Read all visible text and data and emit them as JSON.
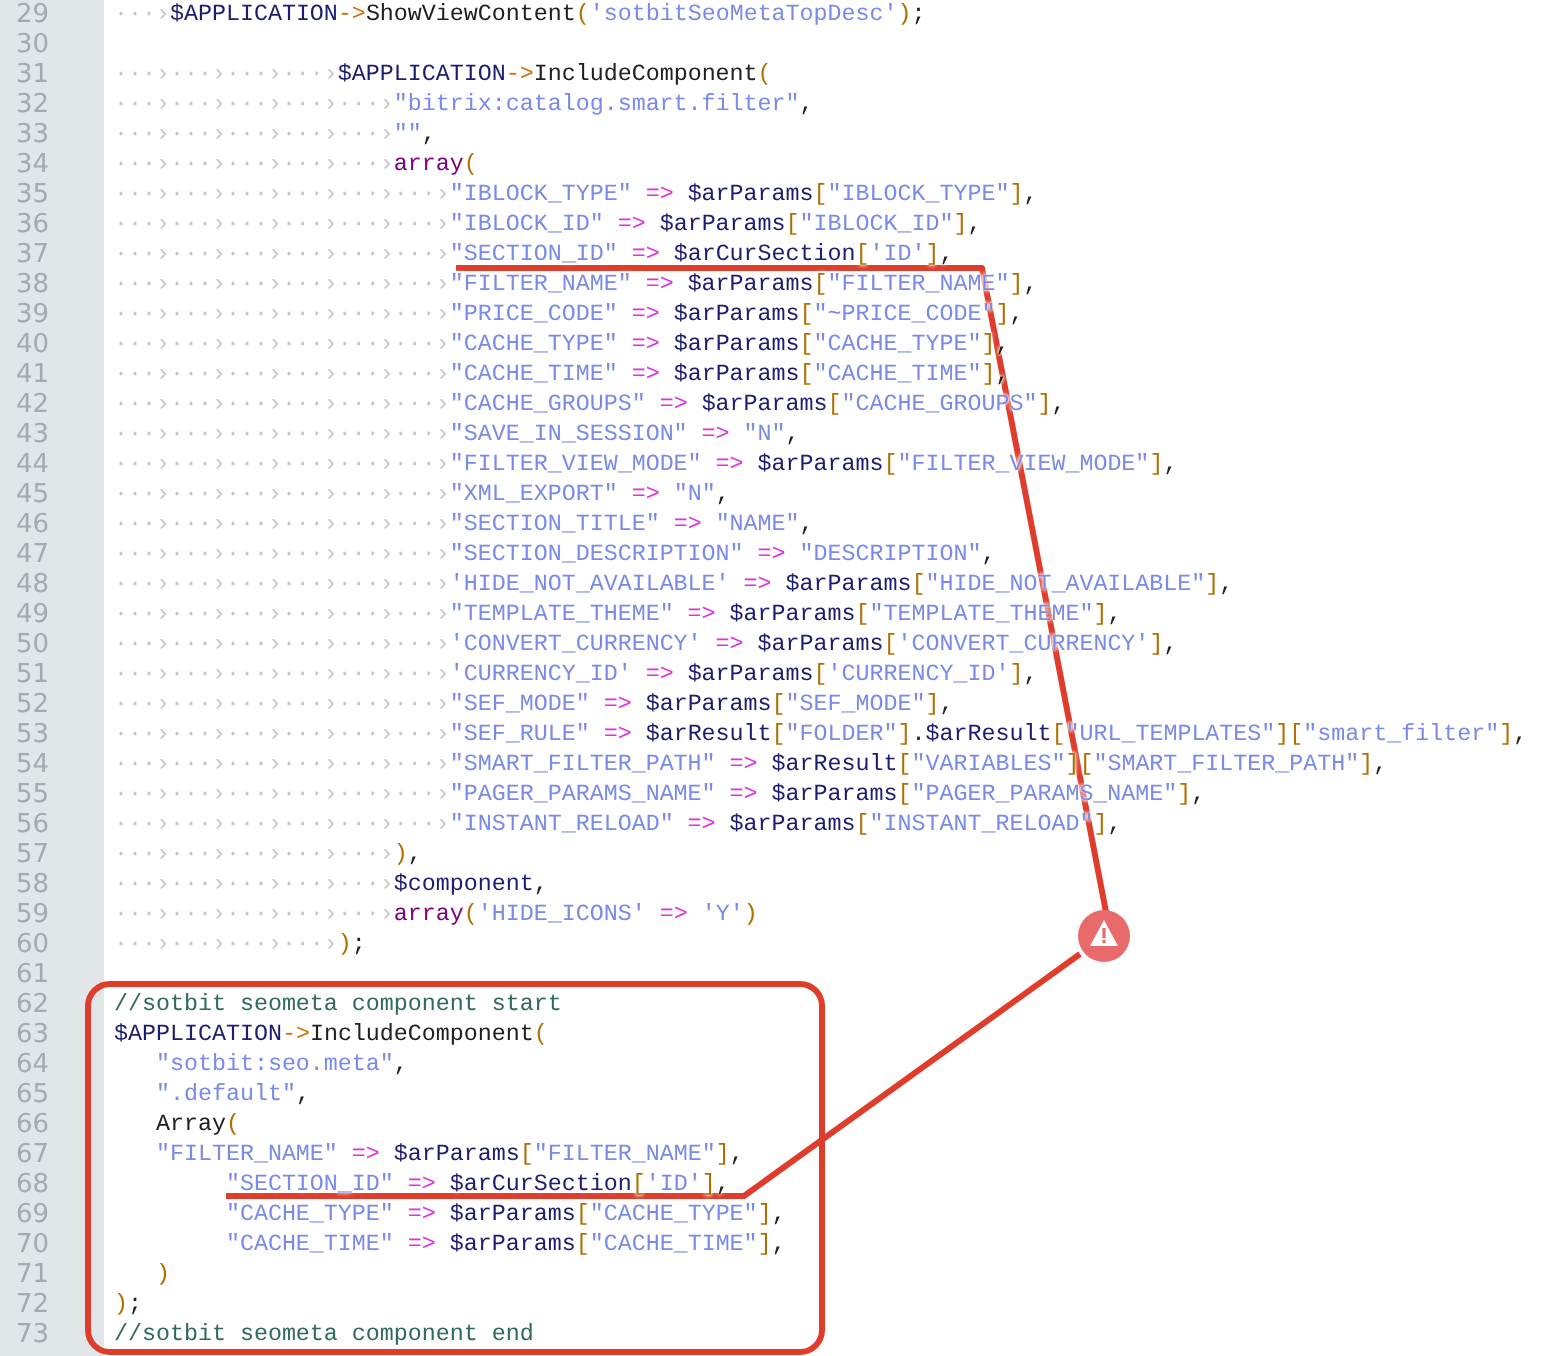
{
  "editor": {
    "lines": [
      {
        "number": "29",
        "whitespace": "···›",
        "tokens": [
          {
            "kind": "var",
            "text": "$APPLICATION"
          },
          {
            "kind": "arrow",
            "text": "->"
          },
          {
            "kind": "func",
            "text": "ShowViewContent"
          },
          {
            "kind": "punct",
            "text": "("
          },
          {
            "kind": "str",
            "text": "'sotbitSeoMetaTopDesc'"
          },
          {
            "kind": "punct",
            "text": ")"
          },
          {
            "kind": "plain",
            "text": ";"
          }
        ]
      },
      {
        "number": "30"
      },
      {
        "number": "31",
        "whitespace": "···›···›···›···›",
        "tokens": [
          {
            "kind": "var",
            "text": "$APPLICATION"
          },
          {
            "kind": "arrow",
            "text": "->"
          },
          {
            "kind": "func",
            "text": "IncludeComponent"
          },
          {
            "kind": "punct",
            "text": "("
          }
        ]
      },
      {
        "number": "32",
        "whitespace": "···›···›···›···›···›",
        "tokens": [
          {
            "kind": "str",
            "text": "\"bitrix:catalog.smart.filter\""
          },
          {
            "kind": "plain",
            "text": ","
          }
        ]
      },
      {
        "number": "33",
        "whitespace": "···›···›···›···›···›",
        "tokens": [
          {
            "kind": "str",
            "text": "\"\""
          },
          {
            "kind": "plain",
            "text": ","
          }
        ]
      },
      {
        "number": "34",
        "whitespace": "···›···›···›···›···›",
        "tokens": [
          {
            "kind": "kw",
            "text": "array"
          },
          {
            "kind": "punct",
            "text": "("
          }
        ]
      },
      {
        "number": "35",
        "whitespace": "···›···›···›···›···›···›",
        "tokens": [
          {
            "kind": "str",
            "text": "\"IBLOCK_TYPE\""
          },
          {
            "kind": "op",
            "text": " => "
          },
          {
            "kind": "var",
            "text": "$arParams"
          },
          {
            "kind": "punct",
            "text": "["
          },
          {
            "kind": "str",
            "text": "\"IBLOCK_TYPE\""
          },
          {
            "kind": "punct",
            "text": "]"
          },
          {
            "kind": "plain",
            "text": ","
          }
        ]
      },
      {
        "number": "36",
        "whitespace": "···›···›···›···›···›···›",
        "tokens": [
          {
            "kind": "str",
            "text": "\"IBLOCK_ID\""
          },
          {
            "kind": "op",
            "text": " => "
          },
          {
            "kind": "var",
            "text": "$arParams"
          },
          {
            "kind": "punct",
            "text": "["
          },
          {
            "kind": "str",
            "text": "\"IBLOCK_ID\""
          },
          {
            "kind": "punct",
            "text": "]"
          },
          {
            "kind": "plain",
            "text": ","
          }
        ]
      },
      {
        "number": "37",
        "whitespace": "···›···›···›···›···›···›",
        "tokens": [
          {
            "kind": "str",
            "text": "\"SECTION_ID\""
          },
          {
            "kind": "op",
            "text": " => "
          },
          {
            "kind": "var",
            "text": "$arCurSection"
          },
          {
            "kind": "punct",
            "text": "["
          },
          {
            "kind": "str",
            "text": "'ID'"
          },
          {
            "kind": "punct",
            "text": "]"
          },
          {
            "kind": "plain",
            "text": ","
          }
        ]
      },
      {
        "number": "38",
        "whitespace": "···›···›···›···›···›···›",
        "tokens": [
          {
            "kind": "str",
            "text": "\"FILTER_NAME\""
          },
          {
            "kind": "op",
            "text": " => "
          },
          {
            "kind": "var",
            "text": "$arParams"
          },
          {
            "kind": "punct",
            "text": "["
          },
          {
            "kind": "str",
            "text": "\"FILTER_NAME\""
          },
          {
            "kind": "punct",
            "text": "]"
          },
          {
            "kind": "plain",
            "text": ","
          }
        ]
      },
      {
        "number": "39",
        "whitespace": "···›···›···›···›···›···›",
        "tokens": [
          {
            "kind": "str",
            "text": "\"PRICE_CODE\""
          },
          {
            "kind": "op",
            "text": " => "
          },
          {
            "kind": "var",
            "text": "$arParams"
          },
          {
            "kind": "punct",
            "text": "["
          },
          {
            "kind": "str",
            "text": "\"~PRICE_CODE\""
          },
          {
            "kind": "punct",
            "text": "]"
          },
          {
            "kind": "plain",
            "text": ","
          }
        ]
      },
      {
        "number": "40",
        "whitespace": "···›···›···›···›···›···›",
        "tokens": [
          {
            "kind": "str",
            "text": "\"CACHE_TYPE\""
          },
          {
            "kind": "op",
            "text": " => "
          },
          {
            "kind": "var",
            "text": "$arParams"
          },
          {
            "kind": "punct",
            "text": "["
          },
          {
            "kind": "str",
            "text": "\"CACHE_TYPE\""
          },
          {
            "kind": "punct",
            "text": "]"
          },
          {
            "kind": "plain",
            "text": ","
          }
        ]
      },
      {
        "number": "41",
        "whitespace": "···›···›···›···›···›···›",
        "tokens": [
          {
            "kind": "str",
            "text": "\"CACHE_TIME\""
          },
          {
            "kind": "op",
            "text": " => "
          },
          {
            "kind": "var",
            "text": "$arParams"
          },
          {
            "kind": "punct",
            "text": "["
          },
          {
            "kind": "str",
            "text": "\"CACHE_TIME\""
          },
          {
            "kind": "punct",
            "text": "]"
          },
          {
            "kind": "plain",
            "text": ","
          }
        ]
      },
      {
        "number": "42",
        "whitespace": "···›···›···›···›···›···›",
        "tokens": [
          {
            "kind": "str",
            "text": "\"CACHE_GROUPS\""
          },
          {
            "kind": "op",
            "text": " => "
          },
          {
            "kind": "var",
            "text": "$arParams"
          },
          {
            "kind": "punct",
            "text": "["
          },
          {
            "kind": "str",
            "text": "\"CACHE_GROUPS\""
          },
          {
            "kind": "punct",
            "text": "]"
          },
          {
            "kind": "plain",
            "text": ","
          }
        ]
      },
      {
        "number": "43",
        "whitespace": "···›···›···›···›···›···›",
        "tokens": [
          {
            "kind": "str",
            "text": "\"SAVE_IN_SESSION\""
          },
          {
            "kind": "op",
            "text": " => "
          },
          {
            "kind": "str",
            "text": "\"N\""
          },
          {
            "kind": "plain",
            "text": ","
          }
        ]
      },
      {
        "number": "44",
        "whitespace": "···›···›···›···›···›···›",
        "tokens": [
          {
            "kind": "str",
            "text": "\"FILTER_VIEW_MODE\""
          },
          {
            "kind": "op",
            "text": " => "
          },
          {
            "kind": "var",
            "text": "$arParams"
          },
          {
            "kind": "punct",
            "text": "["
          },
          {
            "kind": "str",
            "text": "\"FILTER_VIEW_MODE\""
          },
          {
            "kind": "punct",
            "text": "]"
          },
          {
            "kind": "plain",
            "text": ","
          }
        ]
      },
      {
        "number": "45",
        "whitespace": "···›···›···›···›···›···›",
        "tokens": [
          {
            "kind": "str",
            "text": "\"XML_EXPORT\""
          },
          {
            "kind": "op",
            "text": " => "
          },
          {
            "kind": "str",
            "text": "\"N\""
          },
          {
            "kind": "plain",
            "text": ","
          }
        ]
      },
      {
        "number": "46",
        "whitespace": "···›···›···›···›···›···›",
        "tokens": [
          {
            "kind": "str",
            "text": "\"SECTION_TITLE\""
          },
          {
            "kind": "op",
            "text": " => "
          },
          {
            "kind": "str",
            "text": "\"NAME\""
          },
          {
            "kind": "plain",
            "text": ","
          }
        ]
      },
      {
        "number": "47",
        "whitespace": "···›···›···›···›···›···›",
        "tokens": [
          {
            "kind": "str",
            "text": "\"SECTION_DESCRIPTION\""
          },
          {
            "kind": "op",
            "text": " => "
          },
          {
            "kind": "str",
            "text": "\"DESCRIPTION\""
          },
          {
            "kind": "plain",
            "text": ","
          }
        ]
      },
      {
        "number": "48",
        "whitespace": "···›···›···›···›···›···›",
        "tokens": [
          {
            "kind": "str",
            "text": "'HIDE_NOT_AVAILABLE'"
          },
          {
            "kind": "op",
            "text": " => "
          },
          {
            "kind": "var",
            "text": "$arParams"
          },
          {
            "kind": "punct",
            "text": "["
          },
          {
            "kind": "str",
            "text": "\"HIDE_NOT_AVAILABLE\""
          },
          {
            "kind": "punct",
            "text": "]"
          },
          {
            "kind": "plain",
            "text": ","
          }
        ]
      },
      {
        "number": "49",
        "whitespace": "···›···›···›···›···›···›",
        "tokens": [
          {
            "kind": "str",
            "text": "\"TEMPLATE_THEME\""
          },
          {
            "kind": "op",
            "text": " => "
          },
          {
            "kind": "var",
            "text": "$arParams"
          },
          {
            "kind": "punct",
            "text": "["
          },
          {
            "kind": "str",
            "text": "\"TEMPLATE_THEME\""
          },
          {
            "kind": "punct",
            "text": "]"
          },
          {
            "kind": "plain",
            "text": ","
          }
        ]
      },
      {
        "number": "50",
        "whitespace": "···›···›···›···›···›···›",
        "tokens": [
          {
            "kind": "str",
            "text": "'CONVERT_CURRENCY'"
          },
          {
            "kind": "op",
            "text": " => "
          },
          {
            "kind": "var",
            "text": "$arParams"
          },
          {
            "kind": "punct",
            "text": "["
          },
          {
            "kind": "str",
            "text": "'CONVERT_CURRENCY'"
          },
          {
            "kind": "punct",
            "text": "]"
          },
          {
            "kind": "plain",
            "text": ","
          }
        ]
      },
      {
        "number": "51",
        "whitespace": "···›···›···›···›···›···›",
        "tokens": [
          {
            "kind": "str",
            "text": "'CURRENCY_ID'"
          },
          {
            "kind": "op",
            "text": " => "
          },
          {
            "kind": "var",
            "text": "$arParams"
          },
          {
            "kind": "punct",
            "text": "["
          },
          {
            "kind": "str",
            "text": "'CURRENCY_ID'"
          },
          {
            "kind": "punct",
            "text": "]"
          },
          {
            "kind": "plain",
            "text": ","
          }
        ]
      },
      {
        "number": "52",
        "whitespace": "···›···›···›···›···›···›",
        "tokens": [
          {
            "kind": "str",
            "text": "\"SEF_MODE\""
          },
          {
            "kind": "op",
            "text": " => "
          },
          {
            "kind": "var",
            "text": "$arParams"
          },
          {
            "kind": "punct",
            "text": "["
          },
          {
            "kind": "str",
            "text": "\"SEF_MODE\""
          },
          {
            "kind": "punct",
            "text": "]"
          },
          {
            "kind": "plain",
            "text": ","
          }
        ]
      },
      {
        "number": "53",
        "whitespace": "···›···›···›···›···›···›",
        "tokens": [
          {
            "kind": "str",
            "text": "\"SEF_RULE\""
          },
          {
            "kind": "op",
            "text": " => "
          },
          {
            "kind": "var",
            "text": "$arResult"
          },
          {
            "kind": "punct",
            "text": "["
          },
          {
            "kind": "str",
            "text": "\"FOLDER\""
          },
          {
            "kind": "punct",
            "text": "]"
          },
          {
            "kind": "plain",
            "text": "."
          },
          {
            "kind": "var",
            "text": "$arResult"
          },
          {
            "kind": "punct",
            "text": "["
          },
          {
            "kind": "str",
            "text": "\"URL_TEMPLATES\""
          },
          {
            "kind": "punct",
            "text": "]["
          },
          {
            "kind": "str",
            "text": "\"smart_filter\""
          },
          {
            "kind": "punct",
            "text": "]"
          },
          {
            "kind": "plain",
            "text": ","
          }
        ]
      },
      {
        "number": "54",
        "whitespace": "···›···›···›···›···›···›",
        "tokens": [
          {
            "kind": "str",
            "text": "\"SMART_FILTER_PATH\""
          },
          {
            "kind": "op",
            "text": " => "
          },
          {
            "kind": "var",
            "text": "$arResult"
          },
          {
            "kind": "punct",
            "text": "["
          },
          {
            "kind": "str",
            "text": "\"VARIABLES\""
          },
          {
            "kind": "punct",
            "text": "]["
          },
          {
            "kind": "str",
            "text": "\"SMART_FILTER_PATH\""
          },
          {
            "kind": "punct",
            "text": "]"
          },
          {
            "kind": "plain",
            "text": ","
          }
        ]
      },
      {
        "number": "55",
        "whitespace": "···›···›···›···›···›···›",
        "tokens": [
          {
            "kind": "str",
            "text": "\"PAGER_PARAMS_NAME\""
          },
          {
            "kind": "op",
            "text": " => "
          },
          {
            "kind": "var",
            "text": "$arParams"
          },
          {
            "kind": "punct",
            "text": "["
          },
          {
            "kind": "str",
            "text": "\"PAGER_PARAMS_NAME\""
          },
          {
            "kind": "punct",
            "text": "]"
          },
          {
            "kind": "plain",
            "text": ","
          }
        ]
      },
      {
        "number": "56",
        "whitespace": "···›···›···›···›···›···›",
        "tokens": [
          {
            "kind": "str",
            "text": "\"INSTANT_RELOAD\""
          },
          {
            "kind": "op",
            "text": " => "
          },
          {
            "kind": "var",
            "text": "$arParams"
          },
          {
            "kind": "punct",
            "text": "["
          },
          {
            "kind": "str",
            "text": "\"INSTANT_RELOAD\""
          },
          {
            "kind": "punct",
            "text": "]"
          },
          {
            "kind": "plain",
            "text": ","
          }
        ]
      },
      {
        "number": "57",
        "whitespace": "···›···›···›···›···›",
        "tokens": [
          {
            "kind": "punct",
            "text": ")"
          },
          {
            "kind": "plain",
            "text": ","
          }
        ]
      },
      {
        "number": "58",
        "whitespace": "···›···›···›···›···›",
        "tokens": [
          {
            "kind": "var",
            "text": "$component"
          },
          {
            "kind": "plain",
            "text": ","
          }
        ]
      },
      {
        "number": "59",
        "whitespace": "···›···›···›···›···›",
        "tokens": [
          {
            "kind": "kw",
            "text": "array"
          },
          {
            "kind": "punct",
            "text": "("
          },
          {
            "kind": "str",
            "text": "'HIDE_ICONS'"
          },
          {
            "kind": "op",
            "text": " => "
          },
          {
            "kind": "str",
            "text": "'Y'"
          },
          {
            "kind": "punct",
            "text": ")"
          }
        ]
      },
      {
        "number": "60",
        "whitespace": "···›···›···›···›",
        "tokens": [
          {
            "kind": "punct",
            "text": ")"
          },
          {
            "kind": "plain",
            "text": ";"
          }
        ]
      },
      {
        "number": "61"
      },
      {
        "number": "62",
        "tokens": [
          {
            "kind": "comment",
            "text": "//sotbit seometa component start"
          }
        ]
      },
      {
        "number": "63",
        "tokens": [
          {
            "kind": "var",
            "text": "$APPLICATION"
          },
          {
            "kind": "arrow",
            "text": "->"
          },
          {
            "kind": "func",
            "text": "IncludeComponent"
          },
          {
            "kind": "punct",
            "text": "("
          }
        ]
      },
      {
        "number": "64",
        "tokens": [
          {
            "kind": "str",
            "text": "   \"sotbit:seo.meta\""
          },
          {
            "kind": "plain",
            "text": ","
          }
        ]
      },
      {
        "number": "65",
        "tokens": [
          {
            "kind": "str",
            "text": "   \".default\""
          },
          {
            "kind": "plain",
            "text": ","
          }
        ]
      },
      {
        "number": "66",
        "tokens": [
          {
            "kind": "func",
            "text": "   Array"
          },
          {
            "kind": "punct",
            "text": "("
          }
        ]
      },
      {
        "number": "67",
        "tokens": [
          {
            "kind": "str",
            "text": "   \"FILTER_NAME\""
          },
          {
            "kind": "op",
            "text": " => "
          },
          {
            "kind": "var",
            "text": "$arParams"
          },
          {
            "kind": "punct",
            "text": "["
          },
          {
            "kind": "str",
            "text": "\"FILTER_NAME\""
          },
          {
            "kind": "punct",
            "text": "]"
          },
          {
            "kind": "plain",
            "text": ","
          }
        ]
      },
      {
        "number": "68",
        "tokens": [
          {
            "kind": "str",
            "text": "        \"SECTION_ID\""
          },
          {
            "kind": "op",
            "text": " => "
          },
          {
            "kind": "var",
            "text": "$arCurSection"
          },
          {
            "kind": "punct",
            "text": "["
          },
          {
            "kind": "str",
            "text": "'ID'"
          },
          {
            "kind": "punct",
            "text": "]"
          },
          {
            "kind": "plain",
            "text": ","
          }
        ]
      },
      {
        "number": "69",
        "tokens": [
          {
            "kind": "str",
            "text": "        \"CACHE_TYPE\""
          },
          {
            "kind": "op",
            "text": " => "
          },
          {
            "kind": "var",
            "text": "$arParams"
          },
          {
            "kind": "punct",
            "text": "["
          },
          {
            "kind": "str",
            "text": "\"CACHE_TYPE\""
          },
          {
            "kind": "punct",
            "text": "]"
          },
          {
            "kind": "plain",
            "text": ","
          }
        ]
      },
      {
        "number": "70",
        "tokens": [
          {
            "kind": "str",
            "text": "        \"CACHE_TIME\""
          },
          {
            "kind": "op",
            "text": " => "
          },
          {
            "kind": "var",
            "text": "$arParams"
          },
          {
            "kind": "punct",
            "text": "["
          },
          {
            "kind": "str",
            "text": "\"CACHE_TIME\""
          },
          {
            "kind": "punct",
            "text": "]"
          },
          {
            "kind": "plain",
            "text": ","
          }
        ]
      },
      {
        "number": "71",
        "tokens": [
          {
            "kind": "punct",
            "text": "   )"
          }
        ]
      },
      {
        "number": "72",
        "tokens": [
          {
            "kind": "punct",
            "text": ")"
          },
          {
            "kind": "plain",
            "text": ";"
          }
        ]
      },
      {
        "number": "73",
        "tokens": [
          {
            "kind": "comment",
            "text": "//sotbit seometa component end"
          }
        ]
      }
    ]
  }
}
